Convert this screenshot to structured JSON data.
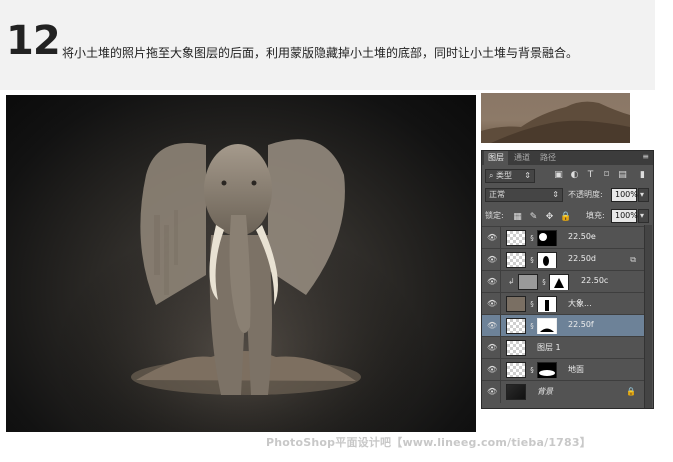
{
  "step": {
    "number": "12",
    "instruction": "将小土堆的照片拖至大象图层的后面，利用蒙版隐藏掉小土堆的底部，同时让小土堆与背景融合。"
  },
  "layers_panel": {
    "tabs": [
      {
        "label": "图层",
        "active": true
      },
      {
        "label": "通道",
        "active": false
      },
      {
        "label": "路径",
        "active": false
      }
    ],
    "filter": {
      "kind_label": "类型",
      "icons": [
        "image-filter-icon",
        "adjustment-filter-icon",
        "type-filter-icon",
        "shape-filter-icon",
        "smart-object-filter-icon",
        "filter-toggle-icon"
      ]
    },
    "blend_mode": "正常",
    "opacity_label": "不透明度:",
    "opacity_value": "100%",
    "lock_label": "锁定:",
    "fill_label": "填充:",
    "fill_value": "100%",
    "layers": [
      {
        "name": "22.50e",
        "visible": true,
        "has_mask": true,
        "clipped": false,
        "selected": false,
        "italic": false,
        "badge": ""
      },
      {
        "name": "22.50d",
        "visible": true,
        "has_mask": true,
        "clipped": false,
        "selected": false,
        "italic": false,
        "badge": "group-badge-icon"
      },
      {
        "name": "22.50c",
        "visible": true,
        "has_mask": true,
        "clipped": true,
        "selected": false,
        "italic": false,
        "badge": ""
      },
      {
        "name": "大象...",
        "visible": true,
        "has_mask": true,
        "clipped": false,
        "selected": false,
        "italic": false,
        "badge": ""
      },
      {
        "name": "22.50f",
        "visible": true,
        "has_mask": true,
        "clipped": false,
        "selected": true,
        "italic": false,
        "badge": ""
      },
      {
        "name": "图层 1",
        "visible": true,
        "has_mask": false,
        "clipped": false,
        "selected": false,
        "italic": false,
        "badge": ""
      },
      {
        "name": "地面",
        "visible": true,
        "has_mask": true,
        "clipped": false,
        "selected": false,
        "italic": false,
        "badge": ""
      },
      {
        "name": "背景",
        "visible": true,
        "has_mask": false,
        "clipped": false,
        "selected": false,
        "italic": true,
        "badge": "lock-icon"
      }
    ]
  },
  "watermark": "PhotoShop平面设计吧【www.lineeg.com/tieba/1783】",
  "colors": {
    "panel_bg": "#535353",
    "selected_row": "#6d8298",
    "header_band": "#f2f2f2"
  }
}
